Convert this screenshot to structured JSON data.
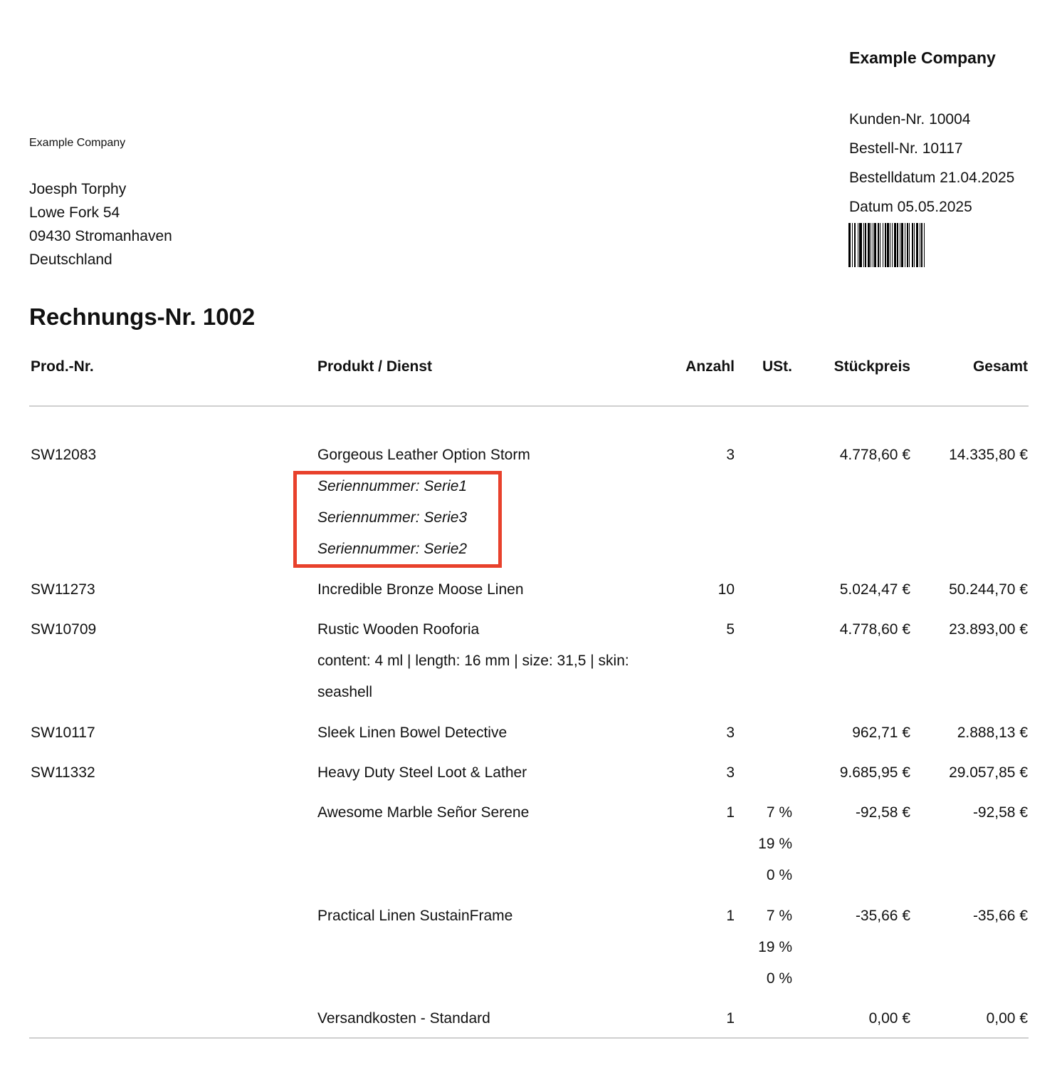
{
  "header": {
    "company": "Example Company",
    "customer_no": "Kunden-Nr. 10004",
    "order_no": "Bestell-Nr. 10117",
    "order_date": "Bestelldatum 21.04.2025",
    "date": "Datum 05.05.2025"
  },
  "address": {
    "sender_line": "Example Company",
    "name": "Joesph Torphy",
    "street": "Lowe Fork 54",
    "city": "09430 Stromanhaven",
    "country": "Deutschland"
  },
  "invoice_title": "Rechnungs-Nr. 1002",
  "table": {
    "headers": {
      "nr": "Prod.-Nr.",
      "product": "Produkt / Dienst",
      "qty": "Anzahl",
      "tax": "USt.",
      "unit_price": "Stückpreis",
      "total": "Gesamt"
    },
    "rows": [
      {
        "nr": "SW12083",
        "product": "Gorgeous Leather Option Storm",
        "details": [
          "Seriennummer: Serie1",
          "Seriennummer: Serie3",
          "Seriennummer: Serie2"
        ],
        "qty": "3",
        "unit_price": "4.778,60 €",
        "total": "14.335,80 €"
      },
      {
        "nr": "SW11273",
        "product": "Incredible Bronze Moose Linen",
        "qty": "10",
        "unit_price": "5.024,47 €",
        "total": "50.244,70 €"
      },
      {
        "nr": "SW10709",
        "product": "Rustic Wooden Rooforia",
        "details": [
          "content: 4 ml | length: 16 mm | size: 31,5 | skin:",
          "seashell"
        ],
        "qty": "5",
        "unit_price": "4.778,60 €",
        "total": "23.893,00 €"
      },
      {
        "nr": "SW10117",
        "product": "Sleek Linen Bowel Detective",
        "qty": "3",
        "unit_price": "962,71 €",
        "total": "2.888,13 €"
      },
      {
        "nr": "SW11332",
        "product": "Heavy Duty Steel Loot & Lather",
        "qty": "3",
        "unit_price": "9.685,95 €",
        "total": "29.057,85 €"
      },
      {
        "product": "Awesome Marble Señor Serene",
        "qty": "1",
        "tax": [
          "7 %",
          "19 %",
          "0 %"
        ],
        "unit_price": "-92,58 €",
        "total": "-92,58 €"
      },
      {
        "product": "Practical Linen SustainFrame",
        "qty": "1",
        "tax": [
          "7 %",
          "19 %",
          "0 %"
        ],
        "unit_price": "-35,66 €",
        "total": "-35,66 €"
      },
      {
        "product": "Versandkosten - Standard",
        "qty": "1",
        "unit_price": "0,00 €",
        "total": "0,00 €"
      }
    ]
  },
  "colors": {
    "highlight": "#e8412c",
    "rule": "#cfcfcf",
    "text": "#111111"
  }
}
